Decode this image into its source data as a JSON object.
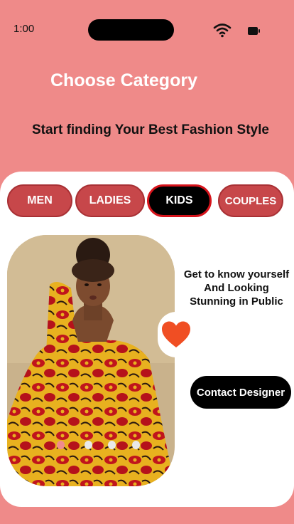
{
  "status": {
    "time": "1:00",
    "wifi_icon": "wifi-icon",
    "battery_icon": "battery-icon"
  },
  "header": {
    "title": "Choose Category",
    "subtitle": "Start finding Your Best Fashion Style"
  },
  "categories": {
    "selected": "KIDS",
    "items": [
      {
        "label": "MEN"
      },
      {
        "label": "LADIES"
      },
      {
        "label": "KIDS"
      },
      {
        "label": "COUPLES"
      }
    ]
  },
  "feature": {
    "image": "girl-in-african-print-dress-photo",
    "carousel": {
      "count": 4,
      "active_index": 0
    },
    "favorite_icon": "heart-icon",
    "tagline": "Get to know yourself\nAnd Looking\nStunning in Public",
    "contact_label": "Contact Designer"
  },
  "colors": {
    "background": "#ef8a89",
    "tab": "#c7474a",
    "tab_selected": "#000000",
    "tab_selected_border": "#d6131b",
    "heart": "#f04e23"
  }
}
